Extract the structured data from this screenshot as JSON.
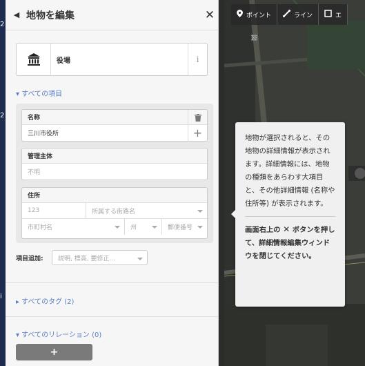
{
  "left_strip": {
    "marks": [
      "2",
      "2",
      "i"
    ]
  },
  "panel": {
    "title": "地物を編集",
    "back_icon": "left-triangle",
    "close_icon": "close-x"
  },
  "preset": {
    "name": "役場",
    "icon": "townhall-icon",
    "info_icon": "i"
  },
  "all_fields_toggle": "▾ すべての項目",
  "fields": {
    "name": {
      "label": "名称",
      "value": "三川市役所"
    },
    "operator": {
      "label": "管理主体",
      "placeholder": "不明"
    },
    "address": {
      "label": "住所",
      "housenumber_placeholder": "123",
      "street_placeholder": "所属する街路名",
      "city_placeholder": "市町村名",
      "state_placeholder": "州",
      "postcode_placeholder": "郵便番号"
    }
  },
  "add_field": {
    "label": "項目追加:",
    "placeholder": "説明, 標高, 要修正..."
  },
  "all_tags_toggle": "▸ すべてのタグ (2)",
  "all_relations_toggle": "▾ すべてのリレーション (0)",
  "add_relation_label": "+",
  "toolbar": {
    "point_label": "ポイント",
    "line_label": "ライン",
    "area_label": "エ"
  },
  "tooltip": {
    "body": "地物が選択されると、その地物の詳細情報が表示されます。詳細情報には、地物の種類をあらわす大項目と、その他詳細情報 (名称や住所等) が表示されます。",
    "action_pre": "画面右上の",
    "action_icon": "✕",
    "action_post": " ボタンを押して、詳細情報編集ウィンドウを閉じてください。"
  },
  "colors": {
    "accent": "#5a7fc4",
    "sidebar_bg": "#f6f6f6",
    "map_bg": "#383a36",
    "toolbar_bg": "#282828"
  }
}
